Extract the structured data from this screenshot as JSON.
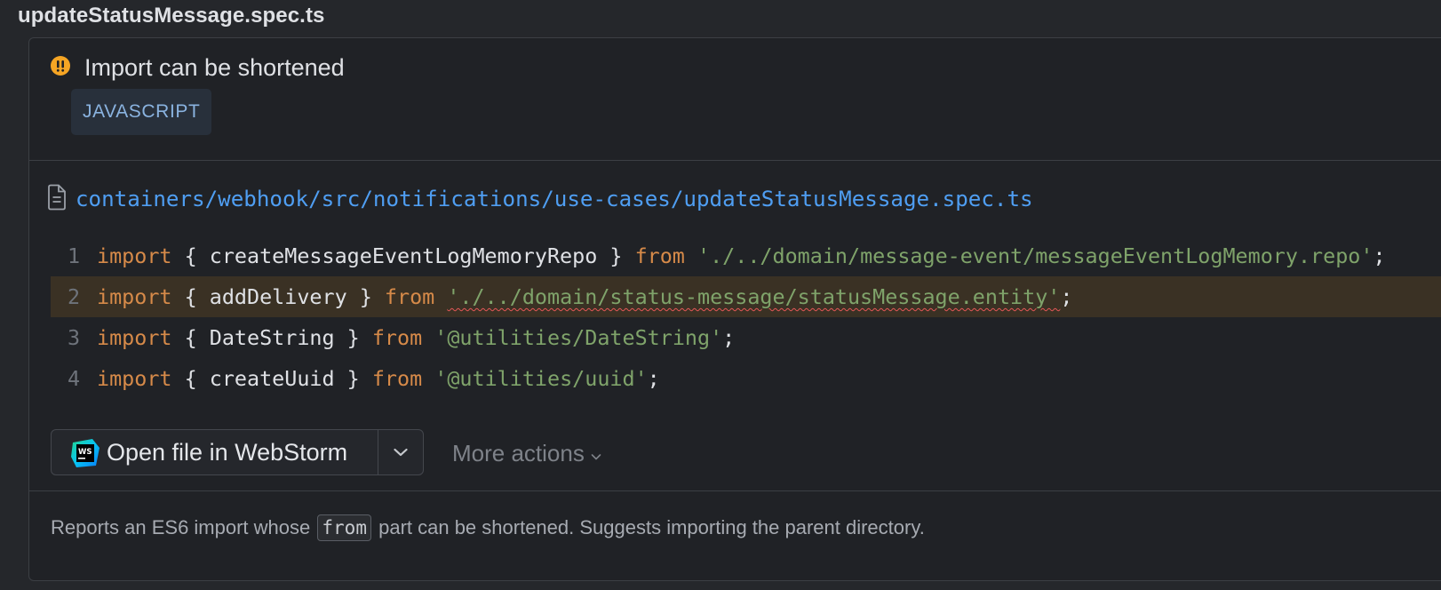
{
  "file_title": "updateStatusMessage.spec.ts",
  "inspection": {
    "severity_icon": "warning-exclamation-icon",
    "severity_color": "#f5a524",
    "title": "Import can be shortened",
    "language": "JAVASCRIPT"
  },
  "file_link": {
    "icon": "file-icon",
    "path": "containers/webhook/src/notifications/use-cases/updateStatusMessage.spec.ts"
  },
  "code": {
    "highlighted_line": 2,
    "lines": [
      {
        "number": "1",
        "kw_import": "import",
        "open": " { ",
        "name": "createMessageEventLogMemoryRepo",
        "close": " } ",
        "kw_from": "from",
        "space": " ",
        "path": "'./../domain/message-event/messageEventLogMemory.repo'",
        "end": ";"
      },
      {
        "number": "2",
        "kw_import": "import",
        "open": " { ",
        "name": "addDelivery",
        "close": " } ",
        "kw_from": "from",
        "space": " ",
        "path": "'./../domain/status-message/statusMessage.entity'",
        "end": ";"
      },
      {
        "number": "3",
        "kw_import": "import",
        "open": " { ",
        "name": "DateString",
        "close": " } ",
        "kw_from": "from",
        "space": " ",
        "path": "'@utilities/DateString'",
        "end": ";"
      },
      {
        "number": "4",
        "kw_import": "import",
        "open": " { ",
        "name": "createUuid",
        "close": " } ",
        "kw_from": "from",
        "space": " ",
        "path": "'@utilities/uuid'",
        "end": ";"
      }
    ]
  },
  "actions": {
    "open_file_label": "Open file in WebStorm",
    "open_file_icon": "webstorm-logo-icon",
    "more_actions_label": "More actions"
  },
  "description": {
    "before": "Reports an ES6 import whose",
    "code": "from",
    "after": "part can be shortened. Suggests importing the parent directory."
  }
}
